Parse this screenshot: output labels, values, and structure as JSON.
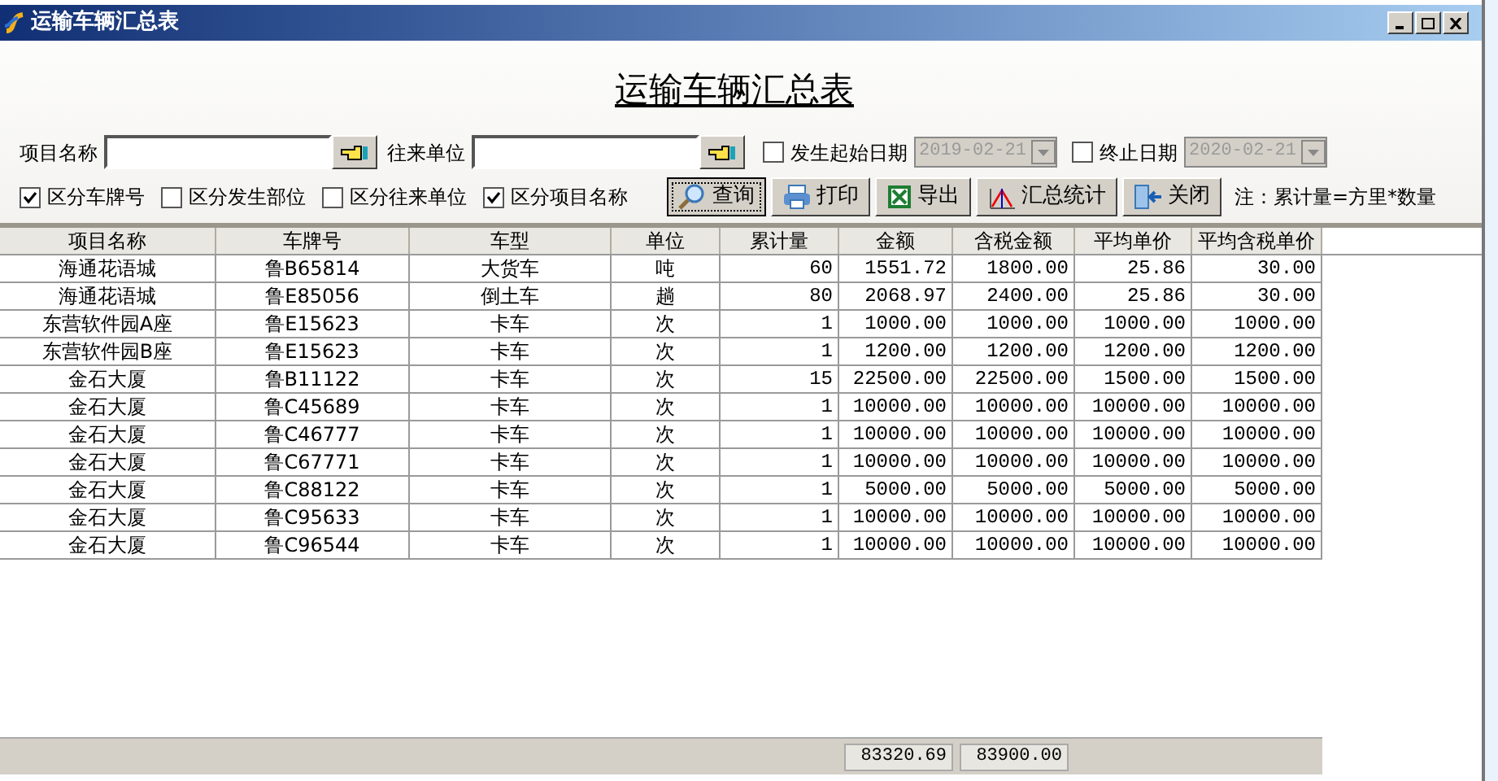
{
  "window": {
    "title": "运输车辆汇总表"
  },
  "heading": "运输车辆汇总表",
  "fields": [
    {
      "label": "项目名称"
    },
    {
      "label": "往来单位"
    }
  ],
  "date_filters": [
    {
      "label": "发生起始日期",
      "checked": false,
      "value": "2019-02-21",
      "disabled": true
    },
    {
      "label": "终止日期",
      "checked": false,
      "value": "2020-02-21",
      "disabled": true
    }
  ],
  "options": [
    {
      "label": "区分车牌号",
      "checked": true
    },
    {
      "label": "区分发生部位",
      "checked": false
    },
    {
      "label": "区分往来单位",
      "checked": false
    },
    {
      "label": "区分项目名称",
      "checked": true
    }
  ],
  "buttons": [
    {
      "label": "查询",
      "kind": "search",
      "focused": true
    },
    {
      "label": "打印",
      "kind": "print",
      "focused": false
    },
    {
      "label": "导出",
      "kind": "excel",
      "focused": false
    },
    {
      "label": "汇总统计",
      "kind": "stats",
      "focused": false
    },
    {
      "label": "关闭",
      "kind": "exit",
      "focused": false
    }
  ],
  "note": "注：累计量=方里*数量",
  "table": {
    "columns": [
      "项目名称",
      "车牌号",
      "车型",
      "单位",
      "累计量",
      "金额",
      "含税金额",
      "平均单价",
      "平均含税单价"
    ],
    "rows": [
      [
        "海通花语城",
        "鲁B65814",
        "大货车",
        "吨",
        "60",
        "1551.72",
        "1800.00",
        "25.86",
        "30.00"
      ],
      [
        "海通花语城",
        "鲁E85056",
        "倒土车",
        "趟",
        "80",
        "2068.97",
        "2400.00",
        "25.86",
        "30.00"
      ],
      [
        "东营软件园A座",
        "鲁E15623",
        "卡车",
        "次",
        "1",
        "1000.00",
        "1000.00",
        "1000.00",
        "1000.00"
      ],
      [
        "东营软件园B座",
        "鲁E15623",
        "卡车",
        "次",
        "1",
        "1200.00",
        "1200.00",
        "1200.00",
        "1200.00"
      ],
      [
        "金石大厦",
        "鲁B11122",
        "卡车",
        "次",
        "15",
        "22500.00",
        "22500.00",
        "1500.00",
        "1500.00"
      ],
      [
        "金石大厦",
        "鲁C45689",
        "卡车",
        "次",
        "1",
        "10000.00",
        "10000.00",
        "10000.00",
        "10000.00"
      ],
      [
        "金石大厦",
        "鲁C46777",
        "卡车",
        "次",
        "1",
        "10000.00",
        "10000.00",
        "10000.00",
        "10000.00"
      ],
      [
        "金石大厦",
        "鲁C67771",
        "卡车",
        "次",
        "1",
        "10000.00",
        "10000.00",
        "10000.00",
        "10000.00"
      ],
      [
        "金石大厦",
        "鲁C88122",
        "卡车",
        "次",
        "1",
        "5000.00",
        "5000.00",
        "5000.00",
        "5000.00"
      ],
      [
        "金石大厦",
        "鲁C95633",
        "卡车",
        "次",
        "1",
        "10000.00",
        "10000.00",
        "10000.00",
        "10000.00"
      ],
      [
        "金石大厦",
        "鲁C96544",
        "卡车",
        "次",
        "1",
        "10000.00",
        "10000.00",
        "10000.00",
        "10000.00"
      ]
    ],
    "totals": [
      "83320.69",
      "83900.00"
    ]
  }
}
